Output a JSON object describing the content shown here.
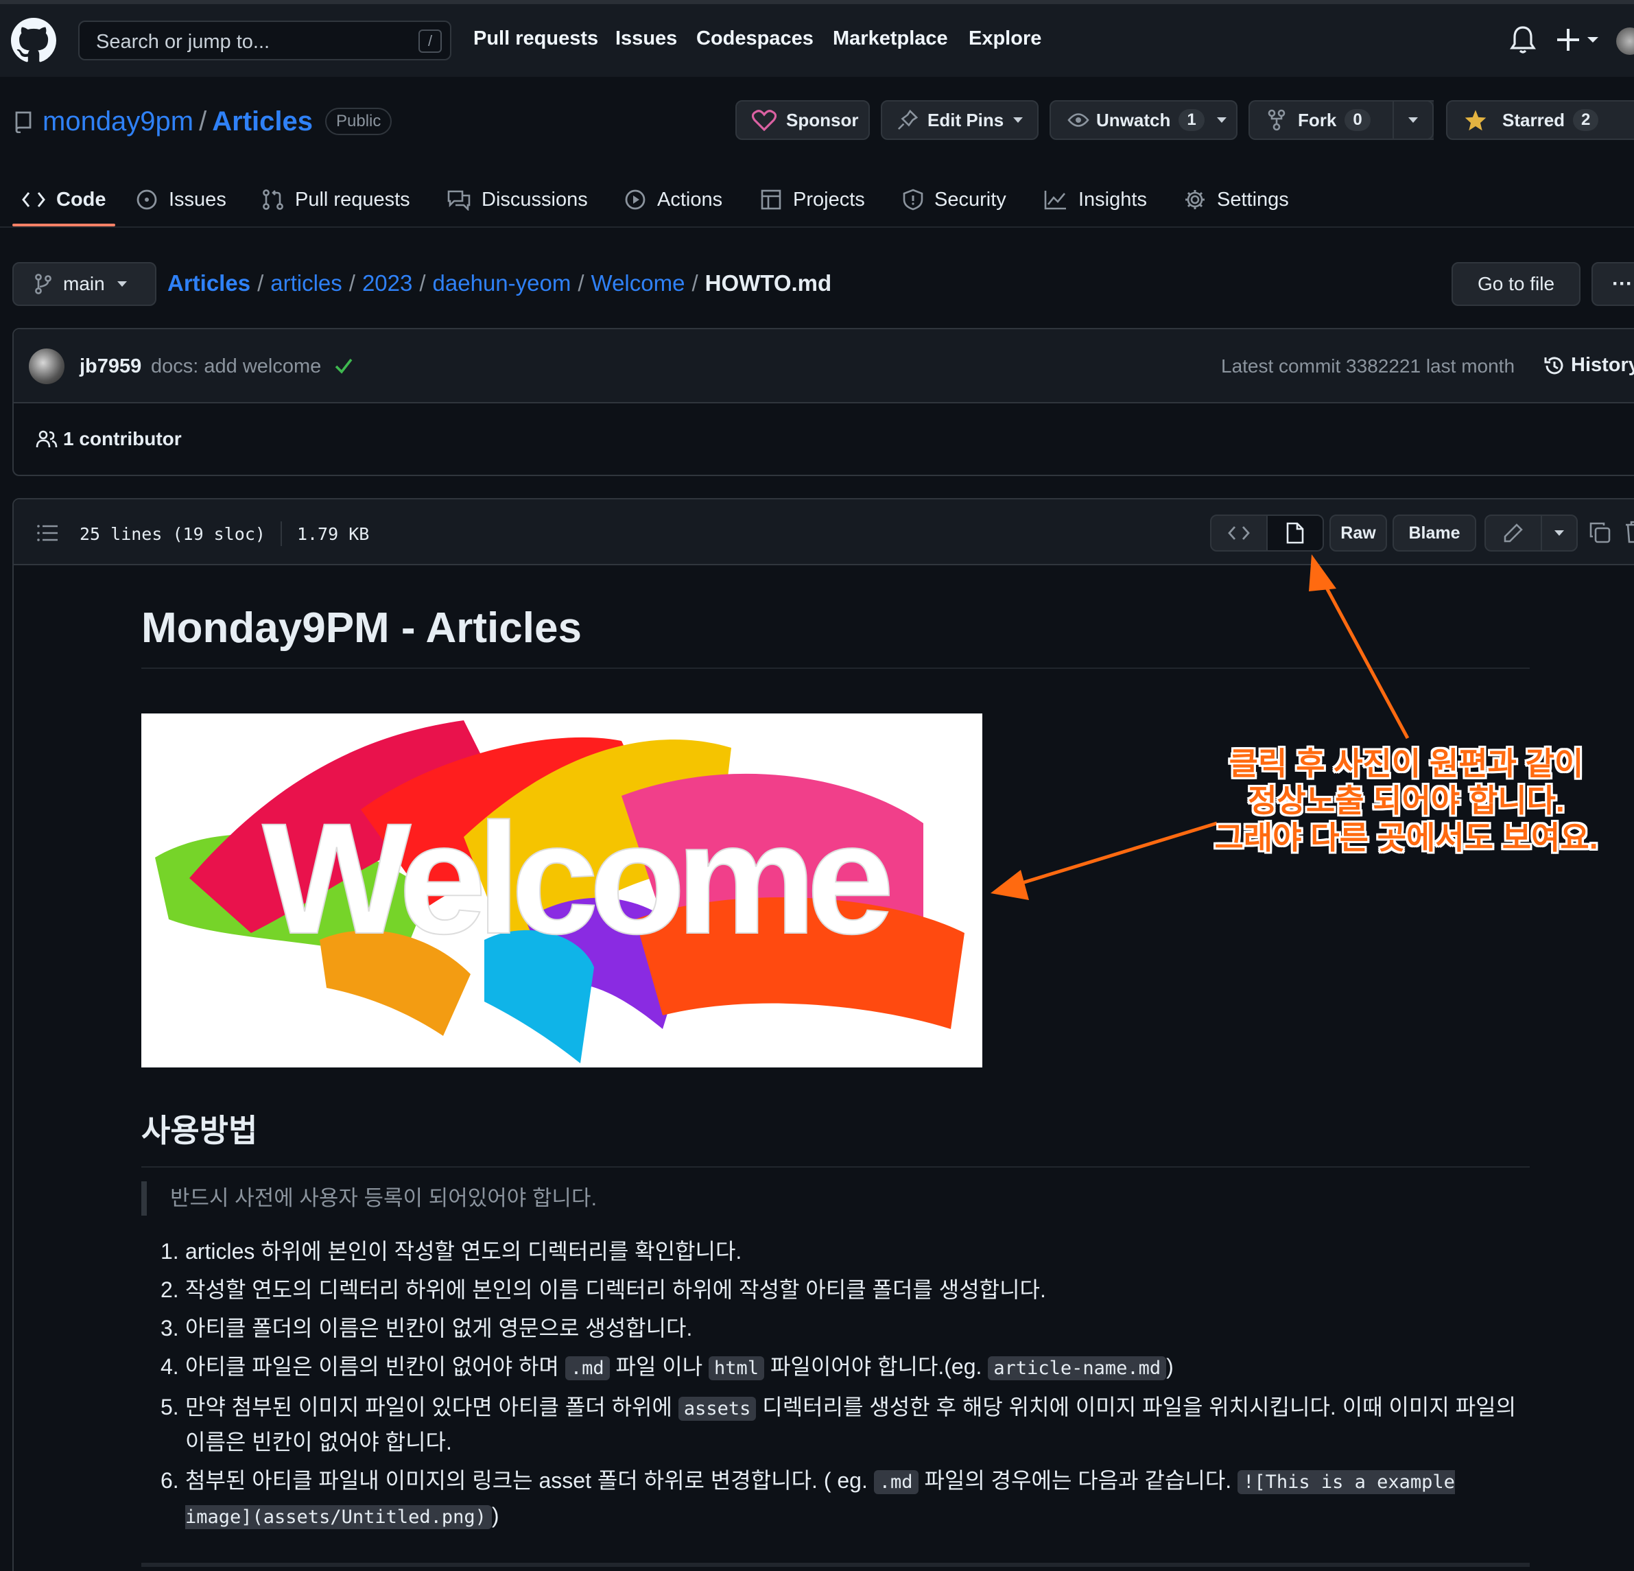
{
  "topbar": {
    "search_placeholder": "Search or jump to...",
    "search_key": "/",
    "nav": [
      "Pull requests",
      "Issues",
      "Codespaces",
      "Marketplace",
      "Explore"
    ]
  },
  "repo": {
    "owner": "monday9pm",
    "separator": "/",
    "name": "Articles",
    "visibility": "Public",
    "sponsor_label": "Sponsor",
    "editpins_label": "Edit Pins",
    "unwatch_label": "Unwatch",
    "unwatch_count": "1",
    "fork_label": "Fork",
    "fork_count": "0",
    "starred_label": "Starred",
    "starred_count": "2"
  },
  "tabs": [
    {
      "label": "Code",
      "icon": "code-icon"
    },
    {
      "label": "Issues",
      "icon": "issue-icon"
    },
    {
      "label": "Pull requests",
      "icon": "pull-request-icon"
    },
    {
      "label": "Discussions",
      "icon": "discussions-icon"
    },
    {
      "label": "Actions",
      "icon": "play-icon"
    },
    {
      "label": "Projects",
      "icon": "table-icon"
    },
    {
      "label": "Security",
      "icon": "shield-icon"
    },
    {
      "label": "Insights",
      "icon": "graph-icon"
    },
    {
      "label": "Settings",
      "icon": "gear-icon"
    }
  ],
  "file_nav": {
    "branch": "main",
    "breadcrumb": [
      "Articles",
      "articles",
      "2023",
      "daehun-yeom",
      "Welcome"
    ],
    "current_file": "HOWTO.md",
    "goto_label": "Go to file",
    "more_label": "···"
  },
  "commit": {
    "author": "jb7959",
    "message": "docs: add welcome",
    "latest": "Latest commit 3382221 last month",
    "history_label": "History",
    "contributors": "1 contributor"
  },
  "file_header": {
    "lines": "25 lines (19 sloc)",
    "size": "1.79 KB",
    "raw_label": "Raw",
    "blame_label": "Blame"
  },
  "markdown": {
    "h1": "Monday9PM - Articles",
    "image_text": "Welcome",
    "h2": "사용방법",
    "quote": "반드시 사전에 사용자 등록이 되어있어야 합니다.",
    "items": [
      {
        "num": "1.",
        "parts": [
          "articles 하위에 본인이 작성할 연도의 디렉터리를 확인합니다."
        ]
      },
      {
        "num": "2.",
        "parts": [
          "작성할 연도의 디렉터리 하위에 본인의 이름 디렉터리 하위에 작성할 아티클 폴더를 생성합니다."
        ]
      },
      {
        "num": "3.",
        "parts": [
          "아티클 폴더의 이름은 빈칸이 없게 영문으로 생성합니다."
        ]
      },
      {
        "num": "4.",
        "parts": [
          "아티클 파일은 이름의 빈칸이 없어야 하며 ",
          ".md",
          " 파일 이나 ",
          "html",
          " 파일이어야 합니다.(eg. ",
          "article-name.md",
          ")"
        ]
      },
      {
        "num": "5.",
        "parts": [
          "만약 첨부된 이미지 파일이 있다면 아티클 폴더 하위에 ",
          "assets",
          " 디렉터리를 생성한 후 해당 위치에 이미지 파일을 위치시킵니다. 이때 이미지 파일의 이름은 빈칸이 없어야 합니다."
        ]
      },
      {
        "num": "6.",
        "parts": [
          "첨부된 아티클 파일내 이미지의 링크는 asset 폴더 하위로 변경합니다. ( eg. ",
          ".md",
          " 파일의 경우에는 다음과 같습니다. ",
          "![This is a example image](assets/Untitled.png)",
          ")"
        ]
      }
    ]
  },
  "annotation": {
    "lines": [
      "클릭 후 사진이 원편과 같이",
      "정상노출 되어야 합니다.",
      "그래야 다른 곳에서도 보여요."
    ],
    "color": "#ff6a10"
  },
  "colors": {
    "background": "#0d1117",
    "link": "#2f81f7",
    "tab_underline": "#f78166",
    "star": "#e3b341"
  }
}
